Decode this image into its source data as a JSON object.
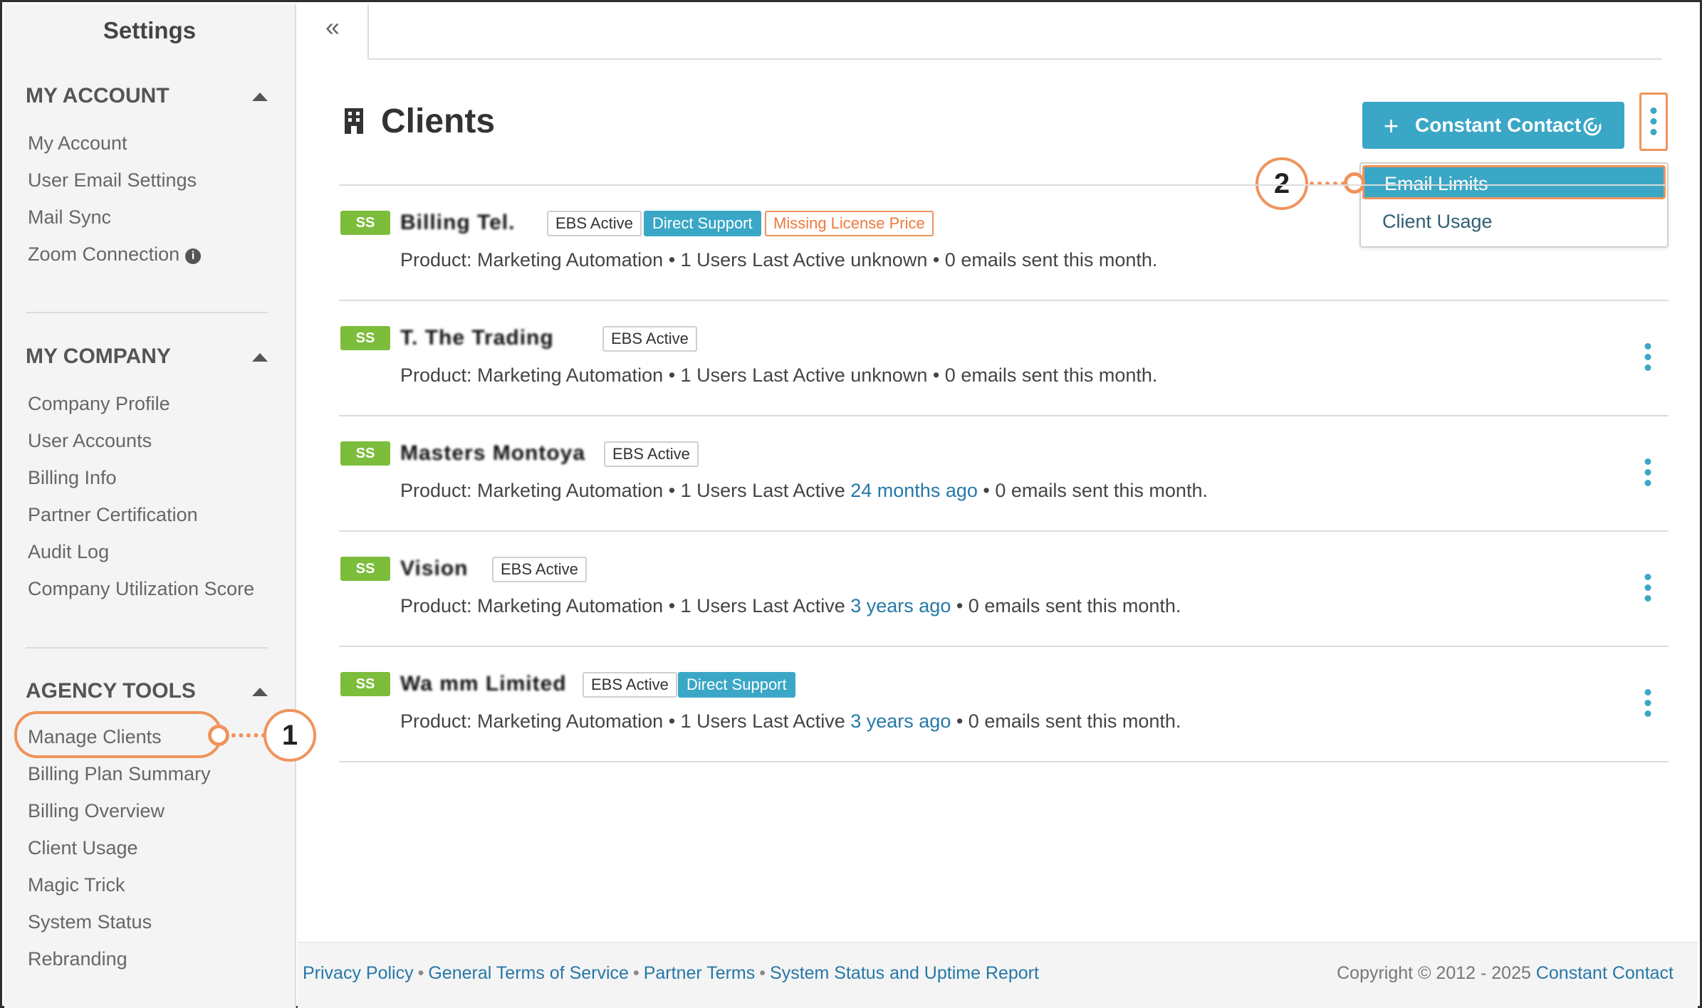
{
  "sidebar": {
    "title": "Settings",
    "sections": [
      {
        "heading": "MY ACCOUNT",
        "items": [
          "My Account",
          "User Email Settings",
          "Mail Sync",
          "Zoom Connection"
        ]
      },
      {
        "heading": "MY COMPANY",
        "items": [
          "Company Profile",
          "User Accounts",
          "Billing Info",
          "Partner Certification",
          "Audit Log",
          "Company Utilization Score"
        ]
      },
      {
        "heading": "AGENCY TOOLS",
        "items": [
          "Manage Clients",
          "Billing Plan Summary",
          "Billing Overview",
          "Client Usage",
          "Magic Trick",
          "System Status",
          "Rebranding"
        ]
      }
    ]
  },
  "header": {
    "collapse_glyph": "«",
    "title": "Clients",
    "primary_button_plus": "+",
    "primary_button_label": "Constant Contact"
  },
  "dropdown": {
    "items": [
      "Email Limits",
      "Client Usage"
    ]
  },
  "callouts": [
    "1",
    "2"
  ],
  "clients": [
    {
      "badge": "SS",
      "name": "Billing Tel.",
      "tags": [
        "EBS Active",
        "Direct Support",
        "Missing License Price"
      ],
      "desc_prefix": "Product: Marketing Automation • 1 Users Last Active ",
      "last_active": "unknown",
      "desc_suffix": " • 0 emails sent this month."
    },
    {
      "badge": "SS",
      "name": "T. The Trading",
      "tags": [
        "EBS Active"
      ],
      "desc_prefix": "Product: Marketing Automation • 1 Users Last Active ",
      "last_active": "unknown",
      "desc_suffix": " • 0 emails sent this month."
    },
    {
      "badge": "SS",
      "name": "Masters Montoya",
      "tags": [
        "EBS Active"
      ],
      "desc_prefix": "Product: Marketing Automation • 1 Users Last Active ",
      "last_active": "24 months ago",
      "desc_suffix": " • 0 emails sent this month."
    },
    {
      "badge": "SS",
      "name": "Vision",
      "tags": [
        "EBS Active"
      ],
      "desc_prefix": "Product: Marketing Automation • 1 Users Last Active ",
      "last_active": "3 years ago",
      "desc_suffix": " • 0 emails sent this month."
    },
    {
      "badge": "SS",
      "name": "Wa mm Limited",
      "tags": [
        "EBS Active",
        "Direct Support"
      ],
      "desc_prefix": "Product: Marketing Automation • 1 Users Last Active ",
      "last_active": "3 years ago",
      "desc_suffix": " • 0 emails sent this month."
    }
  ],
  "footer": {
    "links": [
      "Privacy Policy",
      "General Terms of Service",
      "Partner Terms",
      "System Status and Uptime Report"
    ],
    "separator": "•",
    "copyright_prefix": "Copyright © 2012 - 2025 ",
    "copyright_link": "Constant Contact"
  },
  "colors": {
    "accent": "#3aa7c6",
    "callout": "#f0935c",
    "badge_green": "#7cbd3c",
    "link": "#2678a8"
  }
}
